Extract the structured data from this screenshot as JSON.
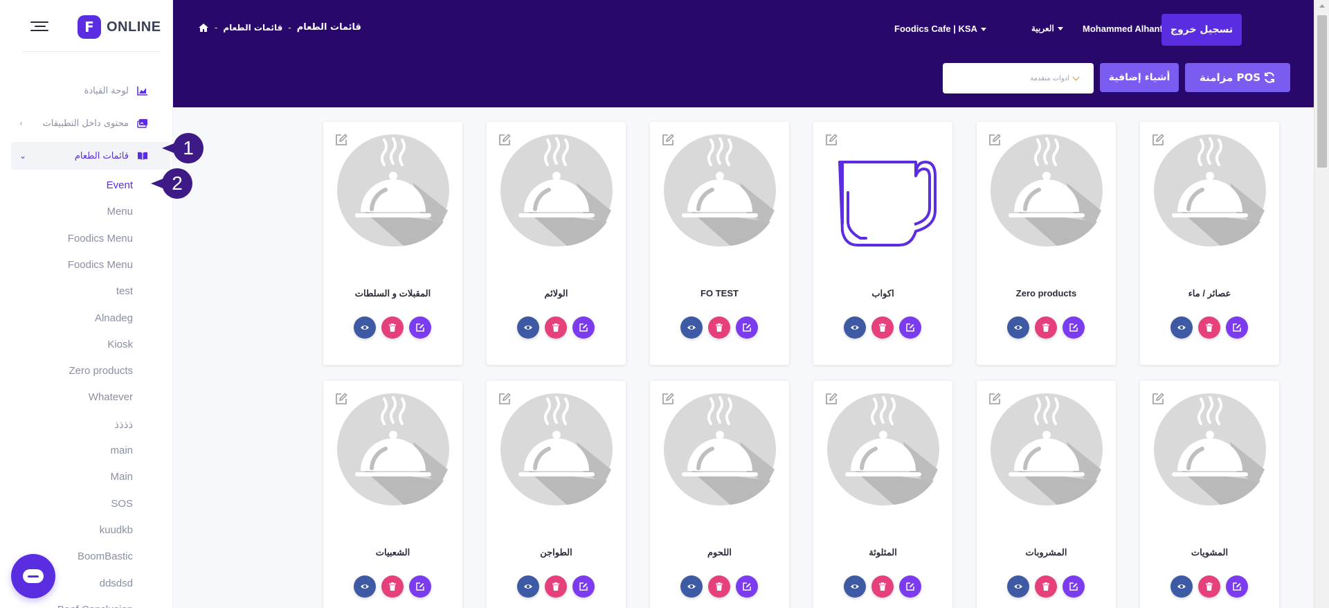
{
  "brand": {
    "logo_letter": "F",
    "name": "ONLINE"
  },
  "sidebar": {
    "nav": [
      {
        "label": "لوحة القيادة",
        "icon": "chart-area-icon"
      },
      {
        "label": "محتوى داخل التطبيقات",
        "icon": "images-icon",
        "chevron": "‹"
      },
      {
        "label": "قائمات الطعام",
        "icon": "book-open-icon",
        "chevron": "⌄"
      }
    ],
    "menus": [
      "Event",
      "Menu",
      "Foodics Menu",
      "Foodics Menu",
      "test",
      "Alnadeg",
      "Kiosk",
      "Zero products",
      "Whatever",
      "ذذذذ",
      "main",
      "Main",
      "SOS",
      "kuudkb",
      "BoomBastic",
      "ddsdsd",
      "Beef Conclusion"
    ],
    "active_menu": "Event",
    "callouts": [
      "1",
      "2"
    ]
  },
  "header": {
    "breadcrumb": {
      "sep": "-",
      "section": "قائمات الطعام",
      "page": "قائمات الطعام"
    },
    "logout_label": "تسجيل خروج",
    "user_name": "Mohammed Alhanfoosh",
    "language": "العربية",
    "branch": "Foodics Cafe | KSA",
    "tools_placeholder": "ادوات متقدمة",
    "extras_label": "أشياء إضافية",
    "pos_sync_label": "مزامنة POS"
  },
  "cards": [
    {
      "title": "عصائر / ماء",
      "image": "food-cover-icon"
    },
    {
      "title": "Zero products",
      "image": "food-cover-icon"
    },
    {
      "title": "اكواب",
      "image": "mug-icon"
    },
    {
      "title": "FO TEST",
      "image": "food-cover-icon"
    },
    {
      "title": "الولائم",
      "image": "food-cover-icon"
    },
    {
      "title": "المقبلات و السلطات",
      "image": "food-cover-icon"
    },
    {
      "title": "المشويات",
      "image": "food-cover-icon"
    },
    {
      "title": "المشروبات",
      "image": "food-cover-icon"
    },
    {
      "title": "المثلوثة",
      "image": "food-cover-icon"
    },
    {
      "title": "اللحوم",
      "image": "food-cover-icon"
    },
    {
      "title": "الطواجن",
      "image": "food-cover-icon"
    },
    {
      "title": "الشعبيات",
      "image": "food-cover-icon"
    }
  ],
  "colors": {
    "header_bg": "#28086a",
    "accent": "#5a2ee0",
    "view_button": "#3e5aa4",
    "delete_button": "#e5407c",
    "edit_button": "#7b3cf0"
  }
}
